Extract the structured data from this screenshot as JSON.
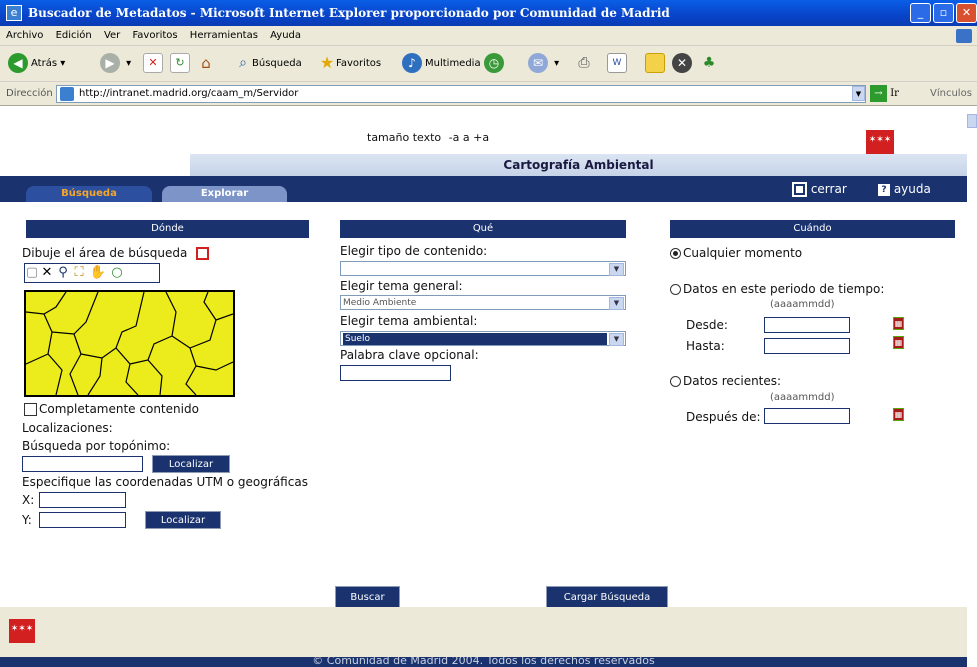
{
  "window": {
    "title": "Buscador de Metadatos - Microsoft Internet Explorer proporcionado por Comunidad de Madrid"
  },
  "menu": [
    "Archivo",
    "Edición",
    "Ver",
    "Favoritos",
    "Herramientas",
    "Ayuda"
  ],
  "toolbar": {
    "back": "Atrás",
    "search": "Búsqueda",
    "favorites": "Favoritos",
    "multimedia": "Multimedia"
  },
  "address": {
    "label": "Dirección",
    "url": "http://intranet.madrid.org/caam_m/Servidor",
    "go": "Ir",
    "links": "Vínculos"
  },
  "header": {
    "text_size_label": "tamaño texto",
    "text_size_controls": "-a a +a",
    "app_title": "Cartografía Ambiental"
  },
  "tabs": [
    {
      "label": "Búsqueda"
    },
    {
      "label": "Explorar"
    }
  ],
  "nav": {
    "close": "cerrar",
    "help": "ayuda"
  },
  "donde": {
    "header": "Dónde",
    "draw_label": "Dibuje el área de búsqueda",
    "fully_contained": "Completamente contenido",
    "locations_label": "Localizaciones:",
    "toponym_label": "Búsqueda por topónimo:",
    "locate_button": "Localizar",
    "coords_label": "Especifique las coordenadas UTM o geográficas",
    "x_label": "X:",
    "y_label": "Y:",
    "locate_button2": "Localizar"
  },
  "que": {
    "header": "Qué",
    "content_type_label": "Elegir tipo de contenido:",
    "content_type_value": "",
    "general_theme_label": "Elegir tema general:",
    "general_theme_value": "Medio Ambiente",
    "env_theme_label": "Elegir tema ambiental:",
    "env_theme_value": "Suelo",
    "keyword_label": "Palabra clave opcional:"
  },
  "cuando": {
    "header": "Cuándo",
    "any_time": "Cualquier momento",
    "period": "Datos en este periodo de tiempo:",
    "date_format": "(aaaammdd)",
    "from": "Desde:",
    "to": "Hasta:",
    "recent": "Datos recientes:",
    "date_format2": "(aaaammdd)",
    "after": "Después de:"
  },
  "actions": {
    "search": "Buscar",
    "load": "Cargar Búsqueda"
  },
  "footer": {
    "copyright": "© Comunidad de Madrid 2004. Todos los derechos reservados"
  },
  "colors": {
    "navy": "#1a326e",
    "map_fill": "#ecec1c",
    "madrid_red": "#d21f1f"
  }
}
